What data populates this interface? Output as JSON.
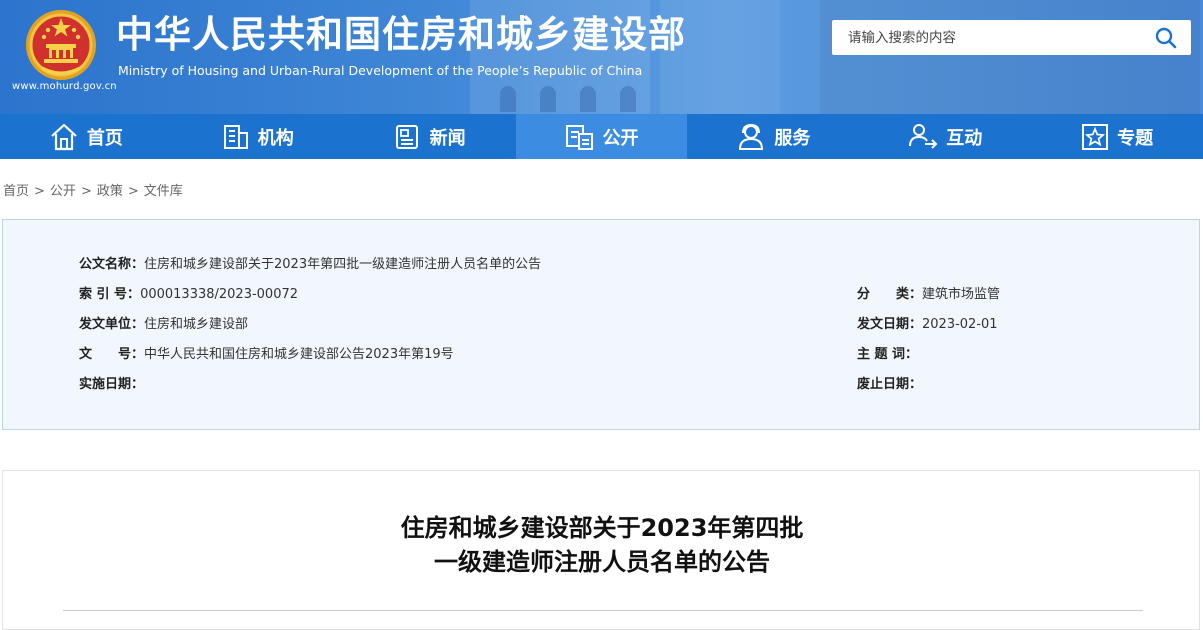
{
  "header": {
    "title": "中华人民共和国住房和城乡建设部",
    "subtitle": "Ministry of Housing and Urban-Rural Development of the People’s Republic of China",
    "url": "www.mohurd.gov.cn",
    "search_placeholder": "请输入搜索的内容"
  },
  "nav": [
    {
      "label": "首页",
      "icon": "home-icon"
    },
    {
      "label": "机构",
      "icon": "building-icon"
    },
    {
      "label": "新闻",
      "icon": "news-icon"
    },
    {
      "label": "公开",
      "icon": "document-icon",
      "active": true
    },
    {
      "label": "服务",
      "icon": "service-icon"
    },
    {
      "label": "互动",
      "icon": "interact-icon"
    },
    {
      "label": "专题",
      "icon": "star-icon"
    }
  ],
  "breadcrumb": [
    "首页",
    "公开",
    "政策",
    "文件库"
  ],
  "meta": {
    "title_label": "公文名称：",
    "title_value": "住房和城乡建设部关于2023年第四批一级建造师注册人员名单的公告",
    "index_label": "索 引 号：",
    "index_value": "000013338/2023-00072",
    "category_label": "分　　类：",
    "category_value": "建筑市场监管",
    "issuer_label": "发文单位：",
    "issuer_value": "住房和城乡建设部",
    "date_label": "发文日期：",
    "date_value": "2023-02-01",
    "docno_label": "文　　号：",
    "docno_value": "中华人民共和国住房和城乡建设部公告2023年第19号",
    "keywords_label": "主 题 词：",
    "keywords_value": "",
    "effective_label": "实施日期：",
    "effective_value": "",
    "expire_label": "废止日期：",
    "expire_value": ""
  },
  "article": {
    "title_line1": "住房和城乡建设部关于2023年第四批",
    "title_line2": "一级建造师注册人员名单的公告"
  },
  "colors": {
    "nav_bg": "#1c72cf",
    "nav_active": "#3c8de2",
    "meta_bg": "#f1f7fd",
    "meta_border": "#bcd5ea"
  }
}
